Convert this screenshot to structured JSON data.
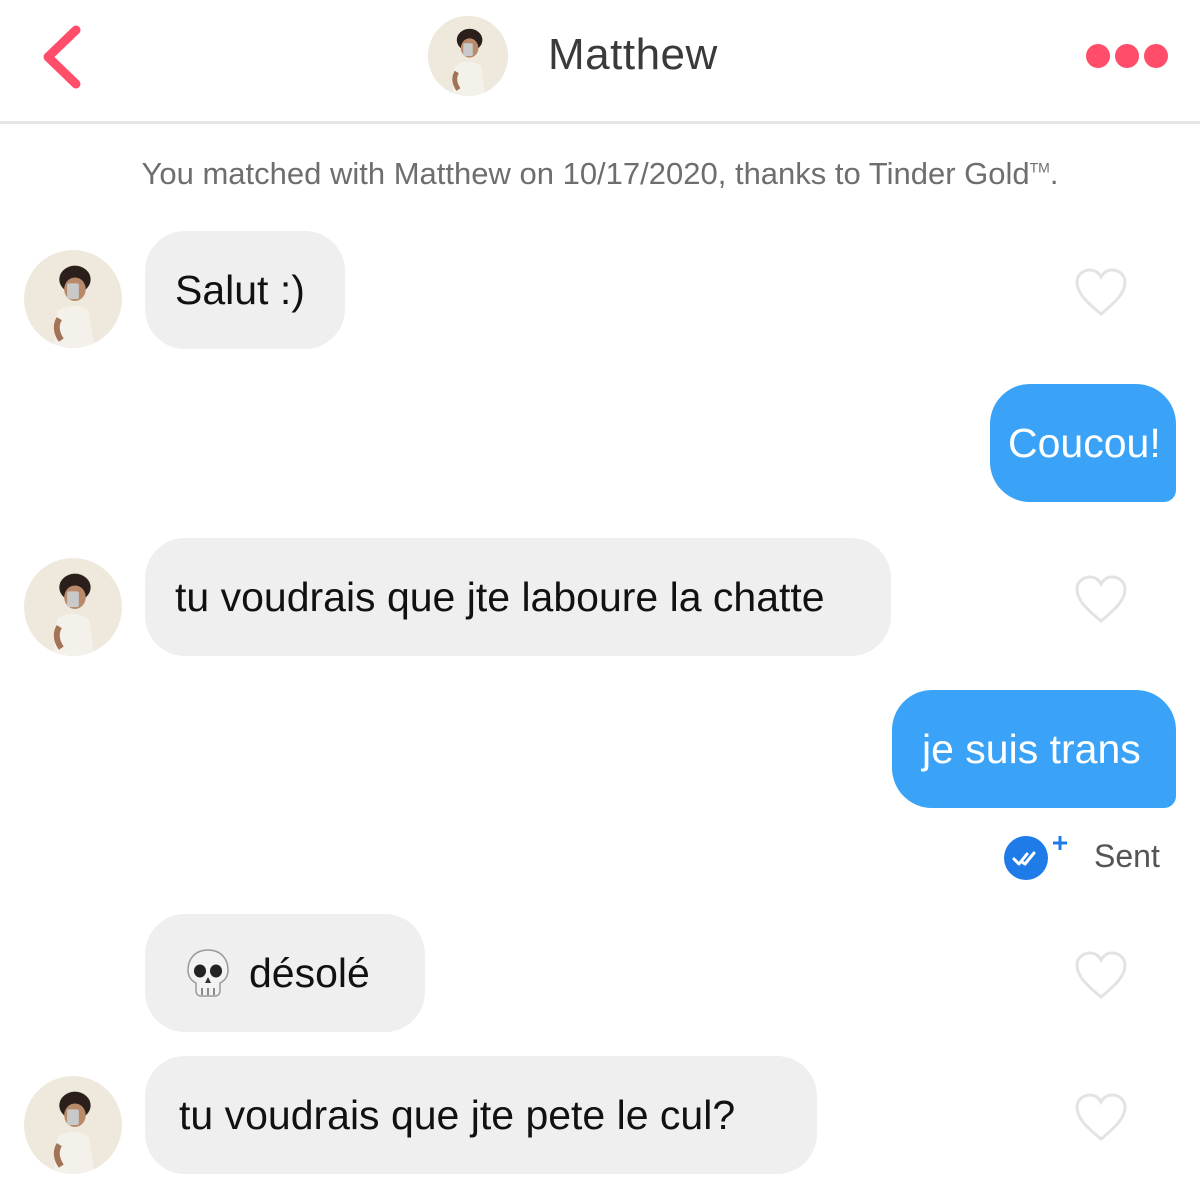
{
  "header": {
    "contact_name": "Matthew",
    "accent_color": "#ff4d6a"
  },
  "match_note": {
    "text": "You matched with Matthew on 10/17/2020, thanks to Tinder Gold",
    "trademark": "TM",
    "trailing": "."
  },
  "messages": [
    {
      "sender": "Matthew",
      "text": "Salut :)"
    },
    {
      "sender": "me",
      "text": "Coucou!"
    },
    {
      "sender": "Matthew",
      "text": "tu voudrais que jte laboure la chatte"
    },
    {
      "sender": "me",
      "text": "je suis trans"
    },
    {
      "sender": "Matthew",
      "emoji": "skull-icon",
      "text": "désolé"
    },
    {
      "sender": "Matthew",
      "text": "tu voudrais que jte pete le cul?"
    }
  ],
  "status": {
    "sent_label": "Sent"
  },
  "colors": {
    "outgoing_bubble": "#3aa3f8",
    "incoming_bubble": "#efefef",
    "read_receipt": "#1f7be8"
  }
}
